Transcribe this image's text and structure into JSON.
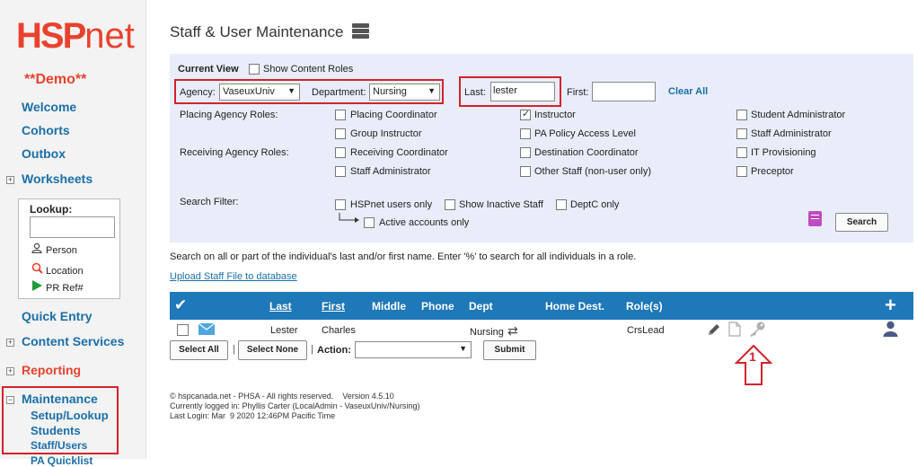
{
  "sidebar": {
    "logo_hsp": "HSP",
    "logo_net": "net",
    "demo": "**Demo**",
    "welcome": "Welcome",
    "cohorts": "Cohorts",
    "outbox": "Outbox",
    "worksheets": "Worksheets",
    "lookup": {
      "title": "Lookup:",
      "person": "Person",
      "location": "Location",
      "prref": "PR Ref#"
    },
    "quick_entry": "Quick Entry",
    "content_services": "Content Services",
    "reporting": "Reporting",
    "maintenance": "Maintenance",
    "setup_lookup": "Setup/Lookup",
    "students": "Students",
    "staff_users": "Staff/Users",
    "pa_quicklist": "PA Quicklist"
  },
  "header": {
    "title": "Staff & User Maintenance"
  },
  "filters": {
    "current_view": "Current View",
    "show_content_roles": "Show Content Roles",
    "agency_label": "Agency:",
    "agency_value": "VaseuxUniv",
    "department_label": "Department:",
    "department_value": "Nursing",
    "last_label": "Last:",
    "last_value": "lester",
    "first_label": "First:",
    "first_value": "",
    "clear_all": "Clear All",
    "placing_roles_label": "Placing Agency Roles:",
    "receiving_roles_label": "Receiving Agency Roles:",
    "roles": {
      "placing_coordinator": "Placing Coordinator",
      "instructor": "Instructor",
      "student_administrator": "Student Administrator",
      "group_instructor": "Group Instructor",
      "pa_policy_access": "PA Policy Access Level",
      "staff_administrator_right": "Staff Administrator",
      "receiving_coordinator": "Receiving Coordinator",
      "destination_coordinator": "Destination Coordinator",
      "it_provisioning": "IT Provisioning",
      "staff_administrator_left": "Staff Administrator",
      "other_staff": "Other Staff (non-user only)",
      "preceptor": "Preceptor"
    },
    "search_filter_label": "Search Filter:",
    "hspnet_users_only": "HSPnet users only",
    "show_inactive_staff": "Show Inactive Staff",
    "deptc_only": "DeptC only",
    "active_accounts_only": "Active accounts only",
    "search_button": "Search"
  },
  "help_text": "Search on all or part of the individual's last and/or first name. Enter '%' to search for all individuals in a role.",
  "upload_link": "Upload Staff File to database",
  "table": {
    "headers": {
      "last": "Last",
      "first": "First",
      "middle": "Middle",
      "phone": "Phone",
      "dept": "Dept",
      "home_dest": "Home Dest.",
      "roles": "Role(s)"
    },
    "row": {
      "last": "Lester",
      "first": "Charles",
      "dept": "Nursing",
      "roles": "CrsLead"
    },
    "select_all": "Select All",
    "select_none": "Select None",
    "action_label": "Action:",
    "submit": "Submit"
  },
  "annotation_number": "1",
  "footer": {
    "line1": "© hspcanada.net - PHSA - All rights reserved.    Version 4.5.10",
    "line2": "Currently logged in: Phyllis Carter (LocalAdmin - VaseuxUniv/Nursing)",
    "line3": "Last Login: Mar  9 2020 12:46PM Pacific Time"
  },
  "colors": {
    "brand_red": "#e8422e",
    "link_blue": "#1a6fa8",
    "table_header": "#1f78b7",
    "highlight_red": "#d3222a",
    "panel_bg": "#e8edf9"
  }
}
